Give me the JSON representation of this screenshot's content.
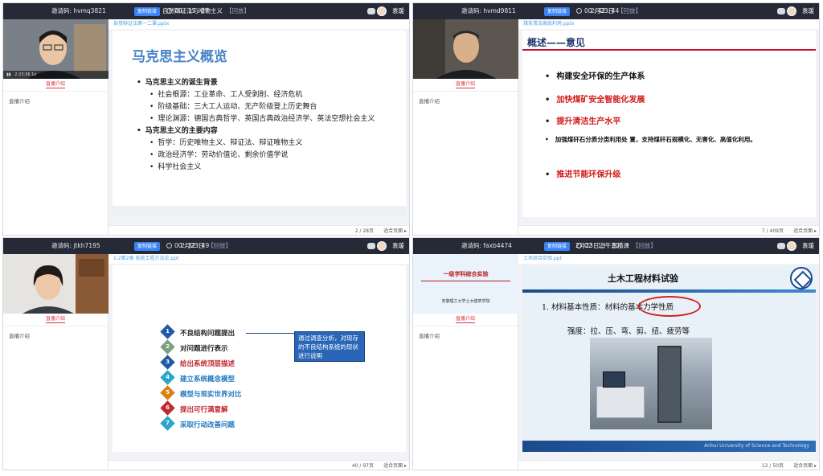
{
  "common": {
    "share_label": "复制链接",
    "user_name": "袁瑗",
    "intro_tab": "直播介绍",
    "intro_text": "直播介绍",
    "fit_label": "适合页面 ▸",
    "replay": "【回放】"
  },
  "q1": {
    "invite": "邀请码: hvmq3821",
    "timer": "00 : 15 : 27",
    "title": "自然辩证法与唯物主义",
    "file": "自然辩证法第一二课.pptx",
    "page": "2 / 28页",
    "video_time": "2:23:36  1x",
    "slide": {
      "heading": "马克思主义概览",
      "items": [
        {
          "lvl": 1,
          "text": "马克思主义的诞生背景"
        },
        {
          "lvl": 2,
          "text": "社会根源：工业革命、工人受剥削、经济危机"
        },
        {
          "lvl": 2,
          "text": "阶级基础：三大工人运动、无产阶级登上历史舞台"
        },
        {
          "lvl": 2,
          "text": "理论渊源：德国古典哲学、英国古典政治经济学、英法空想社会主义"
        },
        {
          "lvl": 1,
          "text": "马克思主义的主要内容"
        },
        {
          "lvl": 2,
          "text": "哲学：历史唯物主义、辩证法、辩证唯物主义"
        },
        {
          "lvl": 2,
          "text": "政治经济学：劳动价值论、剩余价值学说"
        },
        {
          "lvl": 2,
          "text": "科学社会主义"
        }
      ]
    }
  },
  "q2": {
    "invite": "邀请码: hvmd9811",
    "timer": "00 : 42 : 44",
    "title": "2月23日",
    "file": "煤炭清洁高效利用.pptx",
    "page": "7 / 409页",
    "slide": {
      "heading": "概述——意见",
      "b1": "构建安全环保的生产体系",
      "b2": "加快煤矿安全智能化发展",
      "b3": "提升清洁生产水平",
      "b4": "加强煤矸石分质分类利用处 置，支持煤矸石规模化、无害化、高值化利用。",
      "b5": "推进节能环保升级"
    }
  },
  "q3": {
    "invite": "邀请码: jtkh7195",
    "timer": "00 : 32 : 49",
    "title": "2月23日",
    "file": "1-2第2章 系统工程方法论.ppt",
    "page": "40 / 97页",
    "slide": {
      "steps": [
        {
          "n": "1",
          "text": "不良结构问题提出",
          "color": "#1f5aa6",
          "tcolor": "#222"
        },
        {
          "n": "2",
          "text": "对问题进行表示",
          "color": "#7fa07e",
          "tcolor": "#222"
        },
        {
          "n": "3",
          "text": "给出系统顶层描述",
          "color": "#1f5aa6",
          "tcolor": "#c0282f"
        },
        {
          "n": "4",
          "text": "建立系统概念模型",
          "color": "#2aa6c9",
          "tcolor": "#1f78c1"
        },
        {
          "n": "5",
          "text": "模型与现实世界对比",
          "color": "#d9830f",
          "tcolor": "#1f78c1"
        },
        {
          "n": "6",
          "text": "提出可行满意解",
          "color": "#c0282f",
          "tcolor": "#c0282f"
        },
        {
          "n": "7",
          "text": "采取行动改善问题",
          "color": "#2aa6c9",
          "tcolor": "#1f78c1"
        }
      ],
      "callout": "通过调查分析，对现存的不良结构系统的现状进行说明"
    }
  },
  "q4": {
    "invite": "邀请码: faxb4474",
    "timer": "02 : 13 : 30",
    "title": "2月23日上午直播课",
    "file": "土木综合实验.ppt",
    "page": "12 / 50页",
    "thumb_title": "一级学科综合实验",
    "thumb_sub": "安徽理工大学土木建筑学院",
    "slide": {
      "heading": "土木工程材料试验",
      "p1": "1. 材料基本性质：材料的基本力学性质",
      "p2": "强度：拉、压、弯、剪、扭、疲劳等",
      "footer": "Anhui University of Science and Technology"
    }
  }
}
